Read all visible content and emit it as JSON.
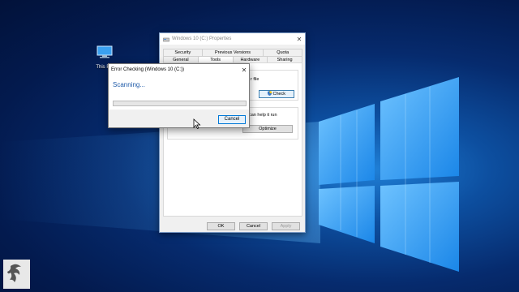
{
  "desktop": {
    "icon_label": "This PC",
    "icon_name": "this-pc-icon",
    "logo_name": "dragon-logo-icon"
  },
  "properties_window": {
    "title": "Windows 10 (C:) Properties",
    "tabs_row1": [
      "Security",
      "Previous Versions",
      "Quota"
    ],
    "tabs_row2": [
      "General",
      "Tools",
      "Hardware",
      "Sharing"
    ],
    "active_tab": "Tools",
    "error_check_text_fragment": "r file",
    "check_button": "Check",
    "optimize_text_fragment": "can help it run",
    "optimize_button": "Optimize",
    "ok_button": "OK",
    "cancel_button": "Cancel",
    "apply_button": "Apply"
  },
  "error_dialog": {
    "title": "Error Checking (Windows 10 (C:))",
    "status": "Scanning...",
    "progress": 0,
    "cancel_button": "Cancel",
    "progress_color": "#06b025"
  }
}
